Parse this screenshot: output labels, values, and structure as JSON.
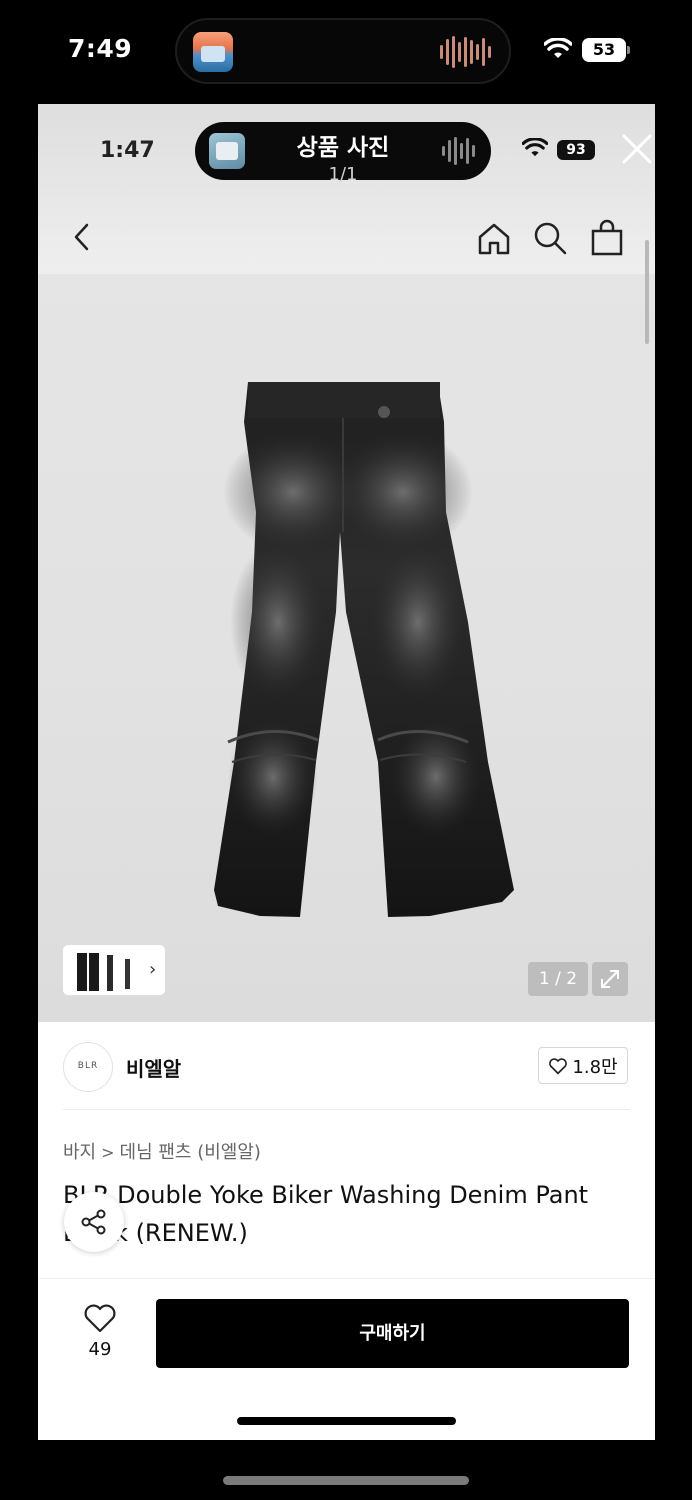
{
  "outer_status": {
    "time": "7:49",
    "battery": "53"
  },
  "inner_status": {
    "time": "1:47",
    "battery": "93"
  },
  "viewer": {
    "title": "상품 사진",
    "counter": "1/1"
  },
  "nav_icons": [
    "back-icon",
    "home-icon",
    "search-icon",
    "bag-icon"
  ],
  "gallery": {
    "page_indicator": "1 / 2"
  },
  "brand": {
    "logo_text": "BLR",
    "name": "비엘알",
    "likes": "1.8만"
  },
  "breadcrumb": {
    "category": "바지",
    "separator": ">",
    "subcategory": "데님 팬츠 (비엘알)"
  },
  "product": {
    "title": "BLR Double Yoke Biker Washing Denim Pant Black (RENEW.)"
  },
  "bottom_bar": {
    "wish_count": "49",
    "buy_label": "구매하기"
  },
  "colors": {
    "buy_button": "#000000",
    "background": "#ffffff"
  }
}
